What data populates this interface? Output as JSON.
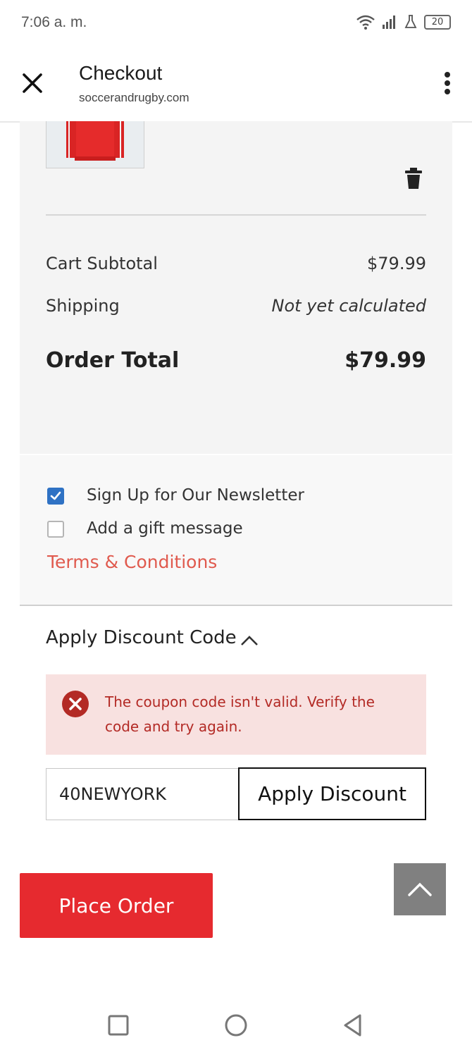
{
  "status_bar": {
    "time": "7:06 a. m.",
    "battery": "20"
  },
  "header": {
    "title": "Checkout",
    "subtitle": "soccerandrugby.com"
  },
  "summary": {
    "subtotal_label": "Cart Subtotal",
    "subtotal_value": "$79.99",
    "shipping_label": "Shipping",
    "shipping_value": "Not yet calculated",
    "total_label": "Order Total",
    "total_value": "$79.99"
  },
  "options": {
    "newsletter_label": "Sign Up for Our Newsletter",
    "newsletter_checked": true,
    "gift_label": "Add a gift message",
    "gift_checked": false,
    "terms_link": "Terms & Conditions"
  },
  "discount": {
    "title": "Apply Discount Code",
    "error_message": "The coupon code isn't valid. Verify the code and try again.",
    "code_value": "40NEWYORK",
    "apply_label": "Apply Discount"
  },
  "place_order_label": "Place Order",
  "colors": {
    "accent_red": "#e62a2f",
    "link_red": "#e05a4e",
    "checkbox_blue": "#2f72c4",
    "error_bg": "#f8e1e0",
    "error_text": "#b32a25"
  },
  "icons": {
    "close": "close-icon",
    "menu": "more-vert-icon",
    "trash": "trash-icon",
    "chevron": "chevron-up-icon",
    "error": "error-circle-icon",
    "scroll_top": "arrow-up-icon"
  }
}
